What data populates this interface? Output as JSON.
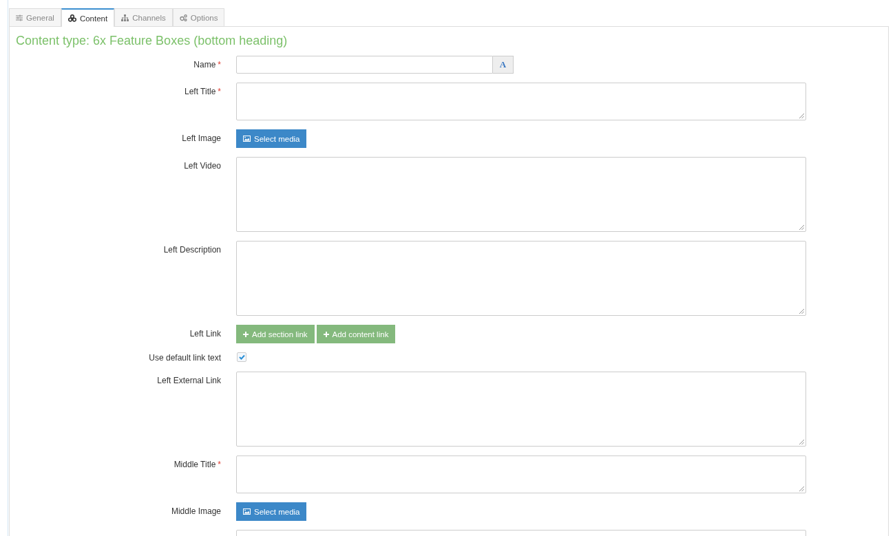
{
  "tabs": [
    {
      "label": "General",
      "selected": false
    },
    {
      "label": "Content",
      "selected": true
    },
    {
      "label": "Channels",
      "selected": false
    },
    {
      "label": "Options",
      "selected": false
    }
  ],
  "heading": "Content type: 6x Feature Boxes (bottom heading)",
  "fields": [
    {
      "kind": "text",
      "label": "Name",
      "required_mark": "*",
      "addon": "A"
    },
    {
      "kind": "textarea-short",
      "label": "Left Title",
      "required_mark": "*"
    },
    {
      "kind": "media",
      "label": "Left Image",
      "button": "Select media"
    },
    {
      "kind": "textarea-tall",
      "label": "Left Video"
    },
    {
      "kind": "textarea-tall",
      "label": "Left Description"
    },
    {
      "kind": "links",
      "label": "Left Link",
      "buttons": [
        "Add section link",
        "Add content link"
      ]
    },
    {
      "kind": "checkbox",
      "label": "Use default link text",
      "checked": true
    },
    {
      "kind": "textarea-tall",
      "label": "Left External Link"
    },
    {
      "kind": "textarea-short",
      "label": "Middle Title",
      "required_mark": "*"
    },
    {
      "kind": "media",
      "label": "Middle Image",
      "button": "Select media"
    },
    {
      "kind": "textarea-tall"
    }
  ]
}
